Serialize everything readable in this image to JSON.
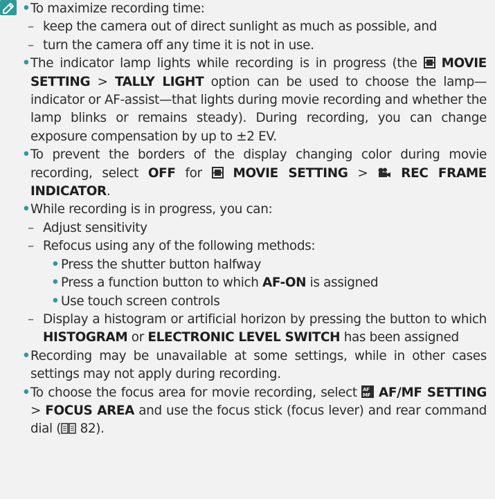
{
  "icons": {
    "note": "note-pencil-icon",
    "movie_setting": "movie-setting-menu-icon",
    "movie_camera": "movie-camera-icon",
    "af_mf": "af-mf-menu-icon",
    "page_ref": "book-reference-icon",
    "accent_color": "#2d9a9a"
  },
  "bullets": {
    "maximize": {
      "text": "To maximize recording time:",
      "sub1": "keep the camera out of direct sunlight as much as possible, and",
      "sub2": "turn the camera off any time it is not in use."
    },
    "lamp": {
      "t1": "The indicator lamp lights while recording is in progress (the ",
      "movie_setting": "MOVIE SETTING",
      "sep": " > ",
      "tally": "TALLY LIGHT",
      "t2": " option can be used to choose the lamp—indicator or AF-assist—that lights during movie recording and whether the lamp blinks or remains steady). During recording, you can change exposure compensation by up to ±2 EV."
    },
    "borders": {
      "t1": "To prevent the borders of the display changing color during movie recording, select ",
      "off": "OFF",
      "t2": " for ",
      "movie_setting": "MOVIE SETTING",
      "sep": " > ",
      "rec_frame": "REC FRAME INDICATOR",
      "t3": "."
    },
    "while": {
      "text": "While recording is in progress, you can:",
      "sensitivity": "Adjust sensitivity",
      "refocus": "Refocus using any of the following methods:",
      "shutter": "Press the shutter button halfway",
      "fn_t1": "Press a function button to which ",
      "af_on": "AF-ON",
      "fn_t2": " is assigned",
      "touch": "Use touch screen controls",
      "hist_t1": "Display a histogram or artificial horizon by pressing the button to which ",
      "histogram": "HISTOGRAM",
      "or": " or ",
      "level": "ELECTRONIC LEVEL SWITCH",
      "hist_t2": " has been assigned"
    },
    "unavailable": {
      "text": "Recording may be unavailable at some settings, while in other cases settings may not apply during recording."
    },
    "focus": {
      "t1": "To choose the focus area for movie recording, select ",
      "af_mf": "AF/MF SETTING",
      "sep": " > ",
      "focus_area": "FOCUS AREA",
      "t2": " and use the focus stick (focus lever) and rear command dial (",
      "page": "82",
      "t3": ")."
    }
  }
}
